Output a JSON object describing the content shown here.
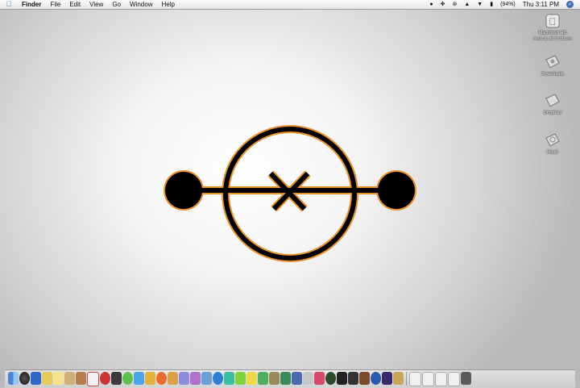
{
  "menubar": {
    "apple_icon": "apple-icon",
    "items": [
      "Finder",
      "File",
      "Edit",
      "View",
      "Go",
      "Window",
      "Help"
    ],
    "status": {
      "battery_text": "(94%)",
      "clock": "Thu 3:11 PM",
      "icons": [
        "user-icon",
        "move-icon",
        "bluetooth-icon",
        "wifi-icon",
        "volume-icon",
        "battery-icon",
        "spotlight-icon"
      ]
    }
  },
  "desktop": {
    "icons": [
      {
        "name": "Macintosh HD",
        "sub": "Poslo db, 60.70 GB free",
        "icon": "hard-drive-icon"
      },
      {
        "name": "Downloads",
        "icon": "folder-icon"
      },
      {
        "name": "Dropress",
        "icon": "folder-icon"
      },
      {
        "name": "Music",
        "icon": "folder-icon"
      }
    ]
  },
  "colors": {
    "emblem_stroke": "#000000",
    "emblem_outline": "#e8922a",
    "apple_blue": "#3d6db5"
  },
  "dock": {
    "apps": [
      "finder-icon",
      "dashboard-icon",
      "word-icon",
      "folder-icon",
      "notes-icon",
      "pencil-icon",
      "contact-icon",
      "calendar-icon",
      "music-icon",
      "network-icon",
      "ichat-icon",
      "itunes-icon",
      "guitar-icon",
      "firefox-icon",
      "photo-icon",
      "preview-icon",
      "backup-icon",
      "mail-icon",
      "globe-icon",
      "colorsync-icon",
      "toolbox-icon",
      "flower-icon",
      "pen-icon",
      "graph-icon",
      "xcode-icon",
      "cube-icon",
      "tools-icon",
      "app-x-icon",
      "globe2-icon",
      "terminal-icon",
      "terminal2-icon",
      "spider-icon",
      "stuff-icon",
      "warcraft-icon",
      "stack-icon"
    ],
    "docs": [
      "doc1-icon",
      "doc2-icon",
      "doc3-icon",
      "doc4-icon",
      "trash-icon"
    ]
  }
}
